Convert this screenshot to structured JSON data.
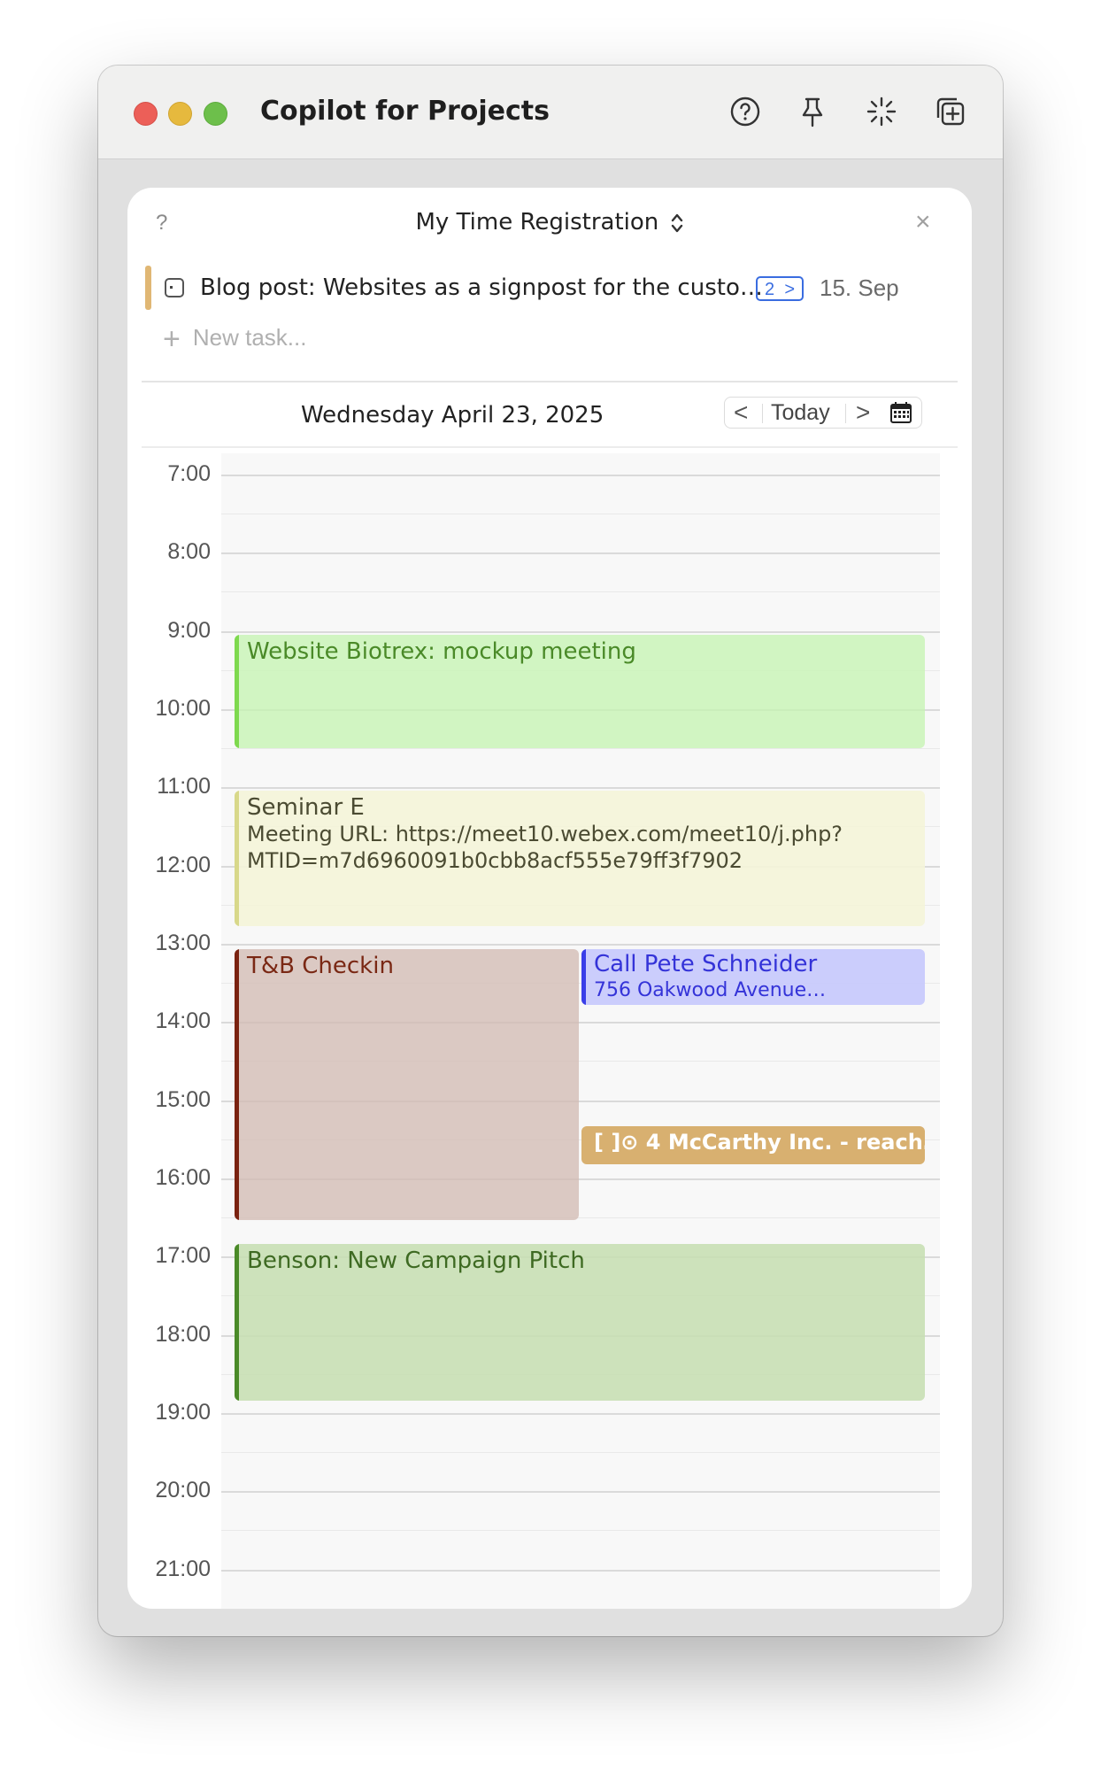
{
  "window": {
    "title": "Copilot for Projects",
    "toolbar_icons": [
      "help-circle-icon",
      "pin-icon",
      "sparkle-icon",
      "add-window-icon"
    ]
  },
  "panel": {
    "help_label": "?",
    "title": "My Time Registration",
    "close_label": "×"
  },
  "task": {
    "title": "Blog post: Websites as a signpost for the custo…",
    "badge_count": "2",
    "badge_chevron": ">",
    "date": "15. Sep"
  },
  "new_task": {
    "plus": "+",
    "placeholder": "New task..."
  },
  "date_nav": {
    "date": "Wednesday April 23, 2025",
    "prev": "<",
    "today": "Today",
    "next": ">"
  },
  "hours": [
    "7:00",
    "8:00",
    "9:00",
    "10:00",
    "11:00",
    "12:00",
    "13:00",
    "14:00",
    "15:00",
    "16:00",
    "17:00",
    "18:00",
    "19:00",
    "20:00",
    "21:00"
  ],
  "events": {
    "biotrex": {
      "title": "Website Biotrex: mockup meeting"
    },
    "seminar": {
      "title": "Seminar E",
      "line1": "Meeting URL: https://meet10.webex.com/meet10/j.php?",
      "line2": "MTID=m7d6960091b0cbb8acf555e79ff3f7902"
    },
    "tb": {
      "title": "T&B Checkin"
    },
    "call": {
      "title": "Call Pete Schneider",
      "address": "756 Oakwood Avenue…"
    },
    "mccarthy": {
      "title": "[ ]⊙ 4 McCarthy Inc. - reach…"
    },
    "benson": {
      "title": "Benson: New Campaign Pitch"
    }
  },
  "colors": {
    "biotrex_accent": "#7ed94e",
    "seminar_accent": "#d8d88a",
    "tb_accent": "#7a2210",
    "call_accent": "#3a3ee8",
    "mccarthy_fill": "#d8b070",
    "benson_accent": "#4a8a28",
    "task_accent": "#e0b774",
    "badge_blue": "#3a6de0"
  }
}
